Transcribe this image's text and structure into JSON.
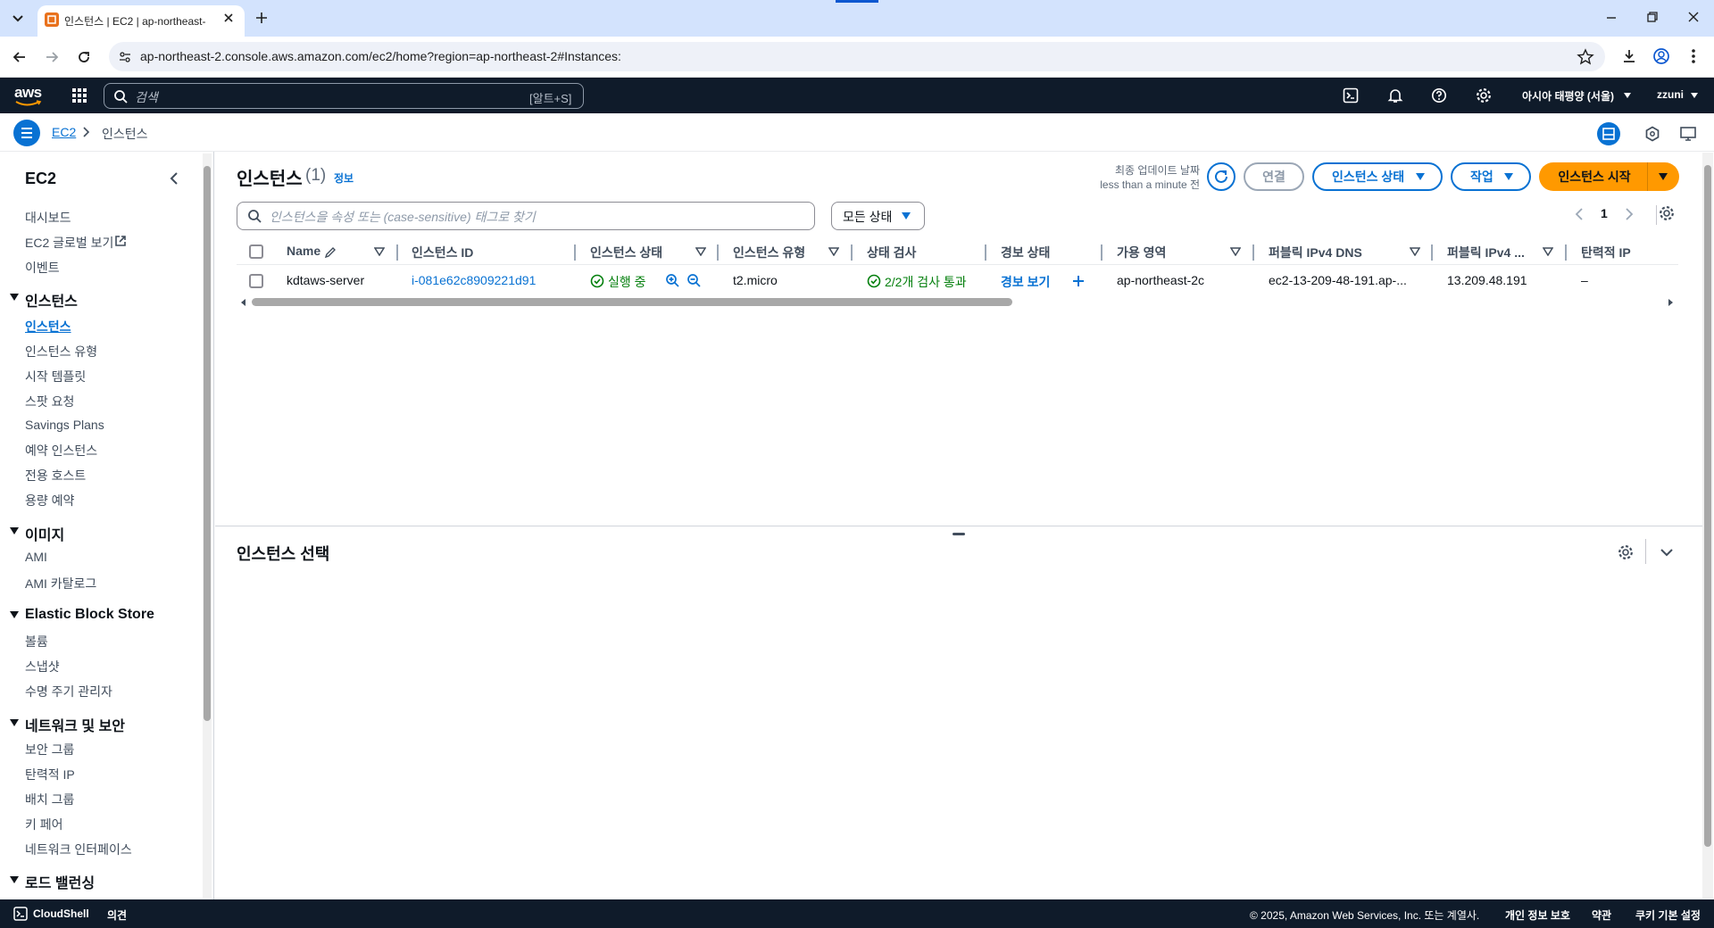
{
  "browser": {
    "tab_title": "인스턴스 | EC2 | ap-northeast-",
    "url": "ap-northeast-2.console.aws.amazon.com/ec2/home?region=ap-northeast-2#Instances:"
  },
  "topnav": {
    "logo": "aws",
    "search_placeholder": "검색",
    "search_shortcut": "[알트+S]",
    "region": "아시아 태평양 (서울)",
    "user": "zzuni"
  },
  "breadcrumb": {
    "root": "EC2",
    "current": "인스턴스"
  },
  "sidebar": {
    "title": "EC2",
    "top_links": [
      "대시보드",
      "EC2 글로벌 보기",
      "이벤트"
    ],
    "sections": [
      {
        "heading": "인스턴스",
        "items": [
          "인스턴스",
          "인스턴스 유형",
          "시작 템플릿",
          "스팟 요청",
          "Savings Plans",
          "예약 인스턴스",
          "전용 호스트",
          "용량 예약"
        ]
      },
      {
        "heading": "이미지",
        "items": [
          "AMI",
          "AMI 카탈로그"
        ]
      },
      {
        "heading": "Elastic Block Store",
        "items": [
          "볼륨",
          "스냅샷",
          "수명 주기 관리자"
        ]
      },
      {
        "heading": "네트워크 및 보안",
        "items": [
          "보안 그룹",
          "탄력적 IP",
          "배치 그룹",
          "키 페어",
          "네트워크 인터페이스"
        ]
      },
      {
        "heading": "로드 밸런싱",
        "items": []
      }
    ]
  },
  "main": {
    "title": "인스턴스",
    "count": "(1)",
    "info_link": "정보",
    "last_updated_label": "최종 업데이트 날짜",
    "last_updated_value": "less than a minute 전",
    "connect_button": "연결",
    "state_button": "인스턴스 상태",
    "actions_button": "작업",
    "launch_button": "인스턴스 시작",
    "filter_placeholder": "인스턴스을 속성 또는 (case-sensitive) 태그로 찾기",
    "state_filter": "모든 상태",
    "page_number": "1",
    "columns": [
      "Name",
      "인스턴스 ID",
      "인스턴스 상태",
      "인스턴스 유형",
      "상태 검사",
      "경보 상태",
      "가용 영역",
      "퍼블릭 IPv4 DNS",
      "퍼블릭 IPv4 ...",
      "탄력적 IP"
    ],
    "rows": [
      {
        "name": "kdtaws-server",
        "instance_id": "i-081e62c8909221d91",
        "state": "실행 중",
        "type": "t2.micro",
        "status_check": "2/2개 검사 통과",
        "alarm": "경보 보기",
        "az": "ap-northeast-2c",
        "public_dns": "ec2-13-209-48-191.ap-...",
        "public_ip": "13.209.48.191",
        "elastic_ip": "–"
      }
    ],
    "detail_title": "인스턴스 선택"
  },
  "footer": {
    "cloudshell": "CloudShell",
    "feedback": "의견",
    "copyright": "© 2025, Amazon Web Services, Inc. 또는 계열사.",
    "privacy": "개인 정보 보호",
    "terms": "약관",
    "cookies": "쿠키 기본 설정"
  },
  "colors": {
    "link": "#0972d3",
    "success": "#037f0c",
    "primary": "#ff9900",
    "nav_bg": "#0f1b2a"
  }
}
